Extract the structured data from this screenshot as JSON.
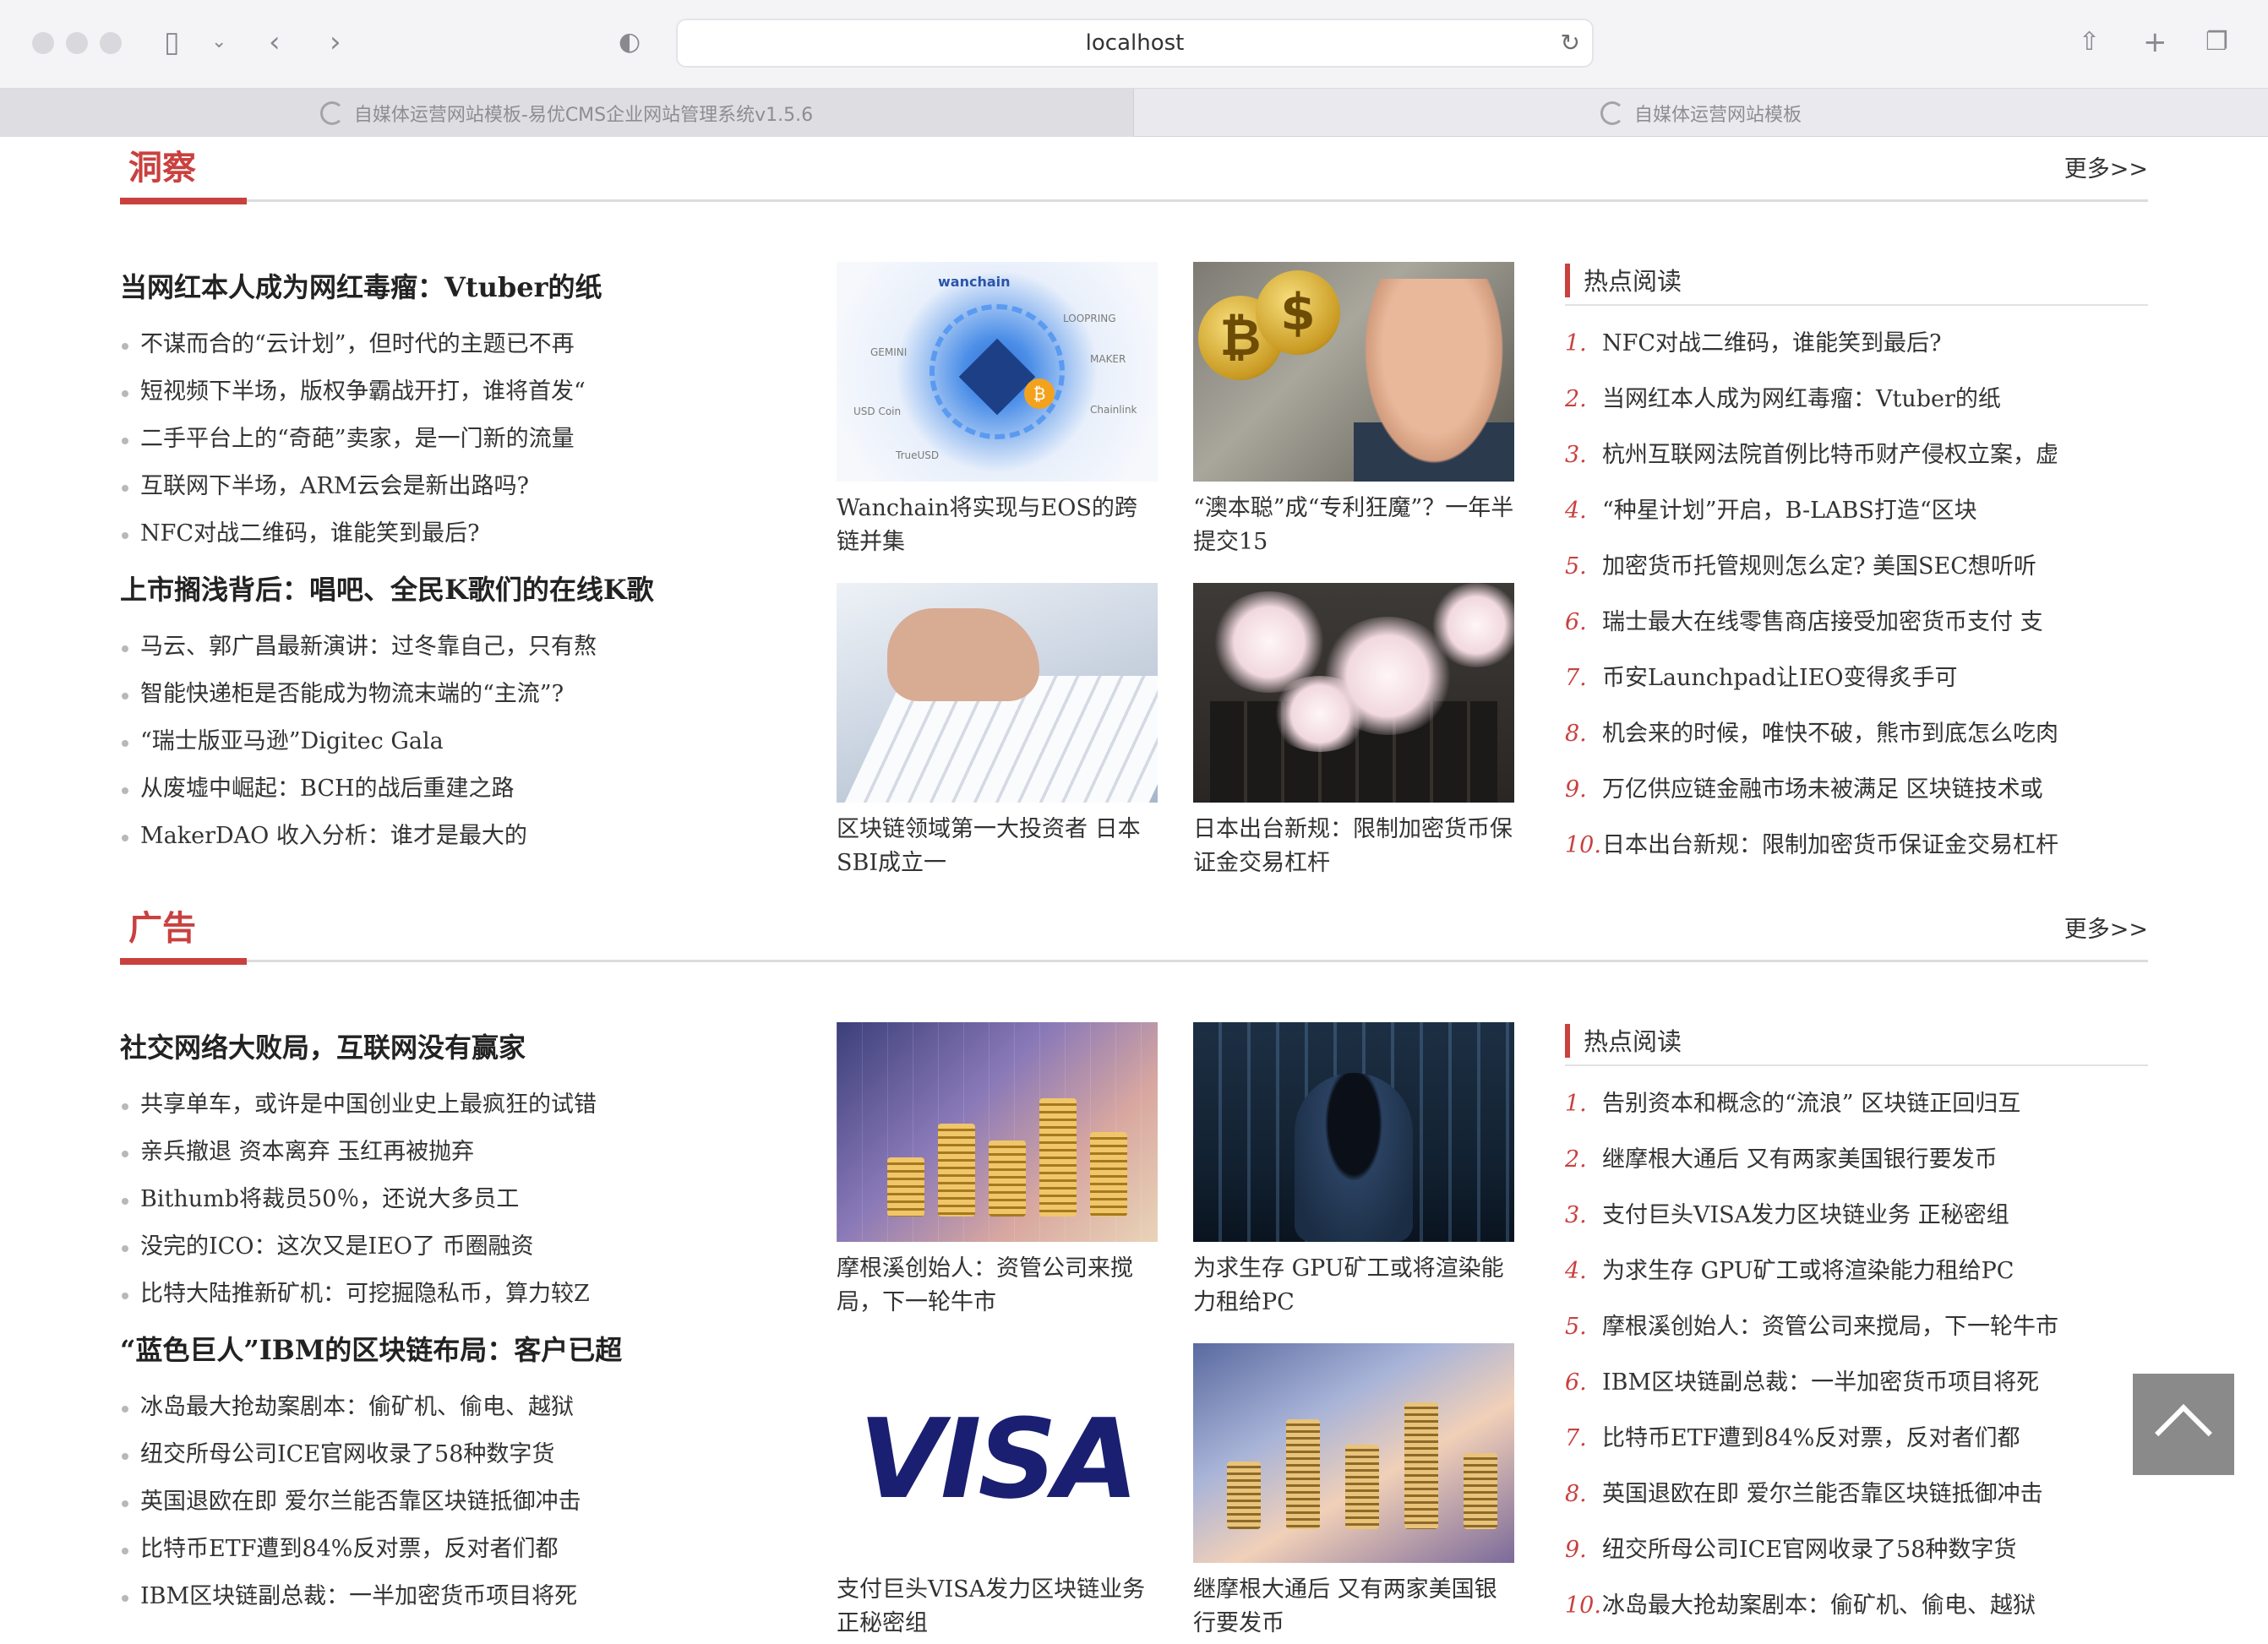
{
  "browser": {
    "url": "localhost",
    "tabs": [
      {
        "label": "自媒体运营网站模板-易优CMS企业网站管理系统v1.5.6",
        "active": true
      },
      {
        "label": "自媒体运营网站模板",
        "active": false
      }
    ]
  },
  "colors": {
    "accent": "#c9413f",
    "text": "#333333"
  },
  "sections": [
    {
      "title": "洞察",
      "more": "更多>>",
      "groups": [
        {
          "headline": "当网红本人成为网红毒瘤：Vtuber的纸",
          "items": [
            "不谋而合的“云计划”，但时代的主题已不再",
            "短视频下半场，版权争霸战开打，谁将首发“",
            "二手平台上的“奇葩”卖家，是一门新的流量",
            "互联网下半场，ARM云会是新出路吗?",
            "NFC对战二维码，谁能笑到最后?"
          ]
        },
        {
          "headline": "上市搁浅背后：唱吧、全民K歌们的在线K歌",
          "items": [
            "马云、郭广昌最新演讲：过冬靠自己，只有熬",
            "智能快递柜是否能成为物流末端的“主流”?",
            "“瑞士版亚马逊”Digitec Gala",
            "从废墟中崛起：BCH的战后重建之路",
            "MakerDAO 收入分析：谁才是最大的"
          ]
        }
      ],
      "thumbs": [
        {
          "caption": "Wanchain将实现与EOS的跨链并集",
          "img": {
            "wanchain": "wanchain",
            "gemini": "GEMINI",
            "usdc": "USD Coin",
            "maker": "MAKER",
            "loopring": "LOOPRING",
            "chainlink": "Chainlink",
            "trueusd": "TrueUSD"
          }
        },
        {
          "caption": "“澳本聪”成“专利狂魔”？一年半提交15"
        },
        {
          "caption": "区块链领域第一大投资者 日本SBI成立一"
        },
        {
          "caption": "日本出台新规：限制加密货币保证金交易杠杆"
        }
      ],
      "hot": {
        "title": "热点阅读",
        "items": [
          "NFC对战二维码，谁能笑到最后?",
          "当网红本人成为网红毒瘤：Vtuber的纸",
          "杭州互联网法院首例比特币财产侵权立案，虚",
          "“种星计划”开启，B-LABS打造“区块",
          "加密货币托管规则怎么定? 美国SEC想听听",
          "瑞士最大在线零售商店接受加密货币支付 支",
          "币安Launchpad让IEO变得炙手可",
          "机会来的时候，唯快不破，熊市到底怎么吃肉",
          "万亿供应链金融市场未被满足 区块链技术或",
          "日本出台新规：限制加密货币保证金交易杠杆"
        ]
      }
    },
    {
      "title": "广告",
      "more": "更多>>",
      "groups": [
        {
          "headline": "社交网络大败局，互联网没有赢家",
          "items": [
            "共享单车，或许是中国创业史上最疯狂的试错",
            "亲兵撤退 资本离弃 玉红再被抛弃",
            "Bithumb将裁员50％，还说大多员工",
            "没完的ICO：这次又是IEO了 币圈融资",
            "比特大陆推新矿机：可挖掘隐私币，算力较Z"
          ]
        },
        {
          "headline": "“蓝色巨人”IBM的区块链布局：客户已超",
          "items": [
            "冰岛最大抢劫案剧本：偷矿机、偷电、越狱",
            "纽交所母公司ICE官网收录了58种数字货",
            "英国退欧在即 爱尔兰能否靠区块链抵御冲击",
            "比特币ETF遭到84%反对票，反对者们都",
            "IBM区块链副总裁：一半加密货币项目将死"
          ]
        }
      ],
      "thumbs": [
        {
          "caption": "摩根溪创始人：资管公司来搅局，下一轮牛市"
        },
        {
          "caption": "为求生存 GPU矿工或将渲染能力租给PC"
        },
        {
          "caption": "支付巨头VISA发力区块链业务 正秘密组",
          "img": {
            "visa": "VISA"
          }
        },
        {
          "caption": "继摩根大通后 又有两家美国银行要发币"
        }
      ],
      "hot": {
        "title": "热点阅读",
        "items": [
          "告别资本和概念的“流浪” 区块链正回归互",
          "继摩根大通后 又有两家美国银行要发币",
          "支付巨头VISA发力区块链业务 正秘密组",
          "为求生存 GPU矿工或将渲染能力租给PC",
          "摩根溪创始人：资管公司来搅局，下一轮牛市",
          "IBM区块链副总裁：一半加密货币项目将死",
          "比特币ETF遭到84%反对票，反对者们都",
          "英国退欧在即 爱尔兰能否靠区块链抵御冲击",
          "纽交所母公司ICE官网收录了58种数字货",
          "冰岛最大抢劫案剧本：偷矿机、偷电、越狱"
        ]
      }
    }
  ]
}
